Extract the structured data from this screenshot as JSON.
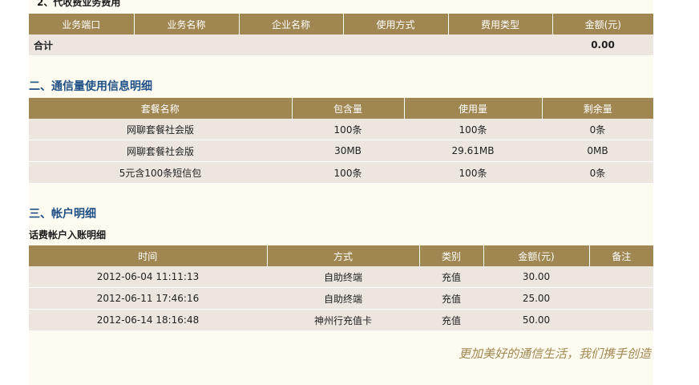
{
  "section1": {
    "title": "2、代收费业务费用",
    "headers": [
      "业务端口",
      "业务名称",
      "企业名称",
      "使用方式",
      "费用类型",
      "金额(元)"
    ],
    "total_label": "合计",
    "total_amount": "0.00"
  },
  "section2": {
    "title": "二、通信量使用信息明细",
    "headers": [
      "套餐名称",
      "包含量",
      "使用量",
      "剩余量"
    ],
    "rows": [
      [
        "网聊套餐社会版",
        "100条",
        "100条",
        "0条"
      ],
      [
        "网聊套餐社会版",
        "30MB",
        "29.61MB",
        "0MB"
      ],
      [
        "5元含100条短信包",
        "100条",
        "100条",
        "0条"
      ]
    ]
  },
  "section3": {
    "title": "三、帐户明细",
    "subtitle": "话费帐户入账明细",
    "headers": [
      "时间",
      "方式",
      "类别",
      "金额(元)",
      "备注"
    ],
    "rows": [
      [
        "2012-06-04 11:11:13",
        "自助终端",
        "充值",
        "30.00",
        ""
      ],
      [
        "2012-06-11 17:46:16",
        "自助终端",
        "充值",
        "25.00",
        ""
      ],
      [
        "2012-06-14 18:16:48",
        "神州行充值卡",
        "充值",
        "50.00",
        ""
      ]
    ]
  },
  "slogan": "更加美好的通信生活，我们携手创造",
  "colors": {
    "header_bg": "#a08751",
    "row_bg": "#ece6de",
    "title_blue": "#1e4f86",
    "page_bg": "#fdfbef"
  }
}
